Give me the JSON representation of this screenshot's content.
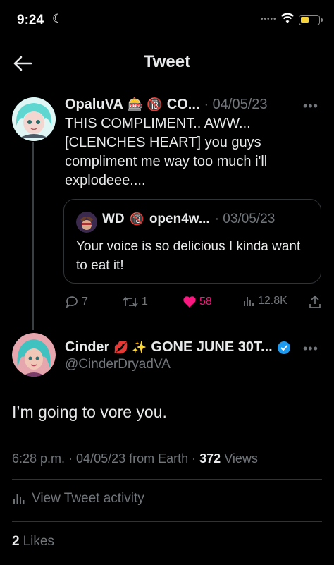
{
  "status_bar": {
    "time": "9:24",
    "moon": "☾",
    "signal": "•••••"
  },
  "header": {
    "title": "Tweet",
    "back_icon": "arrow-left-icon"
  },
  "parent_tweet": {
    "display_name": "OpaluVA",
    "emojis": "🎰 🔞",
    "name_suffix": "CO...",
    "date": "· 04/05/23",
    "more": "•••",
    "text": "THIS COMPLIMENT.. AWW... [CLENCHES HEART] you guys compliment me way too much i'll explodeee....",
    "quote": {
      "display_name": "WD",
      "emoji": "🔞",
      "handle": "open4w...",
      "date": "· 03/05/23",
      "text": "Your voice is so delicious I kinda want to eat it!"
    },
    "actions": {
      "replies": "7",
      "retweets": "1",
      "likes": "58",
      "views": "12.8K"
    },
    "colors": {
      "like": "#f91880"
    }
  },
  "main_tweet": {
    "display_name": "Cinder",
    "emojis": "💋 ✨",
    "name_suffix": "GONE JUNE 30T...",
    "handle": "@CinderDryadVA",
    "more": "•••",
    "text": "I’m going to vore you.",
    "time": "6:28 p.m.",
    "date": "· 04/05/23 from Earth ·",
    "views_count": "372",
    "views_label": "Views",
    "colors": {
      "verified": "#1d9bf0"
    }
  },
  "activity": {
    "label": "View Tweet activity"
  },
  "likes": {
    "count": "2",
    "label": "Likes"
  }
}
